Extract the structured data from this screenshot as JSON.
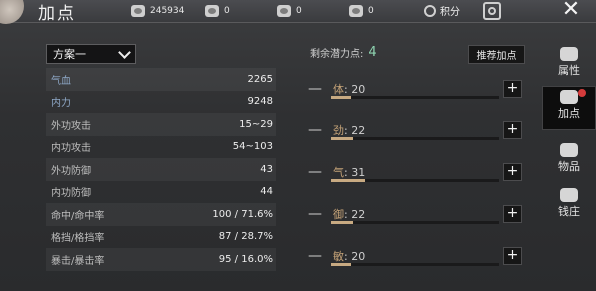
{
  "header": {
    "title": "加点",
    "resources": {
      "gold": "245934",
      "a": "0",
      "b": "0",
      "c": "0"
    },
    "score_label": "积分"
  },
  "left": {
    "plan_select": "方案一",
    "stats": [
      {
        "label": "气血",
        "value": "2265"
      },
      {
        "label": "内力",
        "value": "9248"
      },
      {
        "label": "外功攻击",
        "value": "15~29"
      },
      {
        "label": "内功攻击",
        "value": "54~103"
      },
      {
        "label": "外功防御",
        "value": "43"
      },
      {
        "label": "内功防御",
        "value": "44"
      },
      {
        "label": "命中/命中率",
        "value": "100 / 71.6%"
      },
      {
        "label": "格挡/格挡率",
        "value": "87 / 28.7%"
      },
      {
        "label": "暴击/暴击率",
        "value": "95 / 16.0%"
      }
    ]
  },
  "right": {
    "points_label": "剩余潜力点:",
    "points_value": "4",
    "recommend_label": "推荐加点",
    "attributes": [
      {
        "name": "体",
        "sep": ": ",
        "value": "20",
        "fill": 0.12
      },
      {
        "name": "劲",
        "sep": ": ",
        "value": "22",
        "fill": 0.13
      },
      {
        "name": "气",
        "sep": ": ",
        "value": "31",
        "fill": 0.2
      },
      {
        "name": "御",
        "sep": ": ",
        "value": "22",
        "fill": 0.13
      },
      {
        "name": "敏",
        "sep": ": ",
        "value": "20",
        "fill": 0.12
      }
    ]
  },
  "sidebar": {
    "tabs": [
      "属性",
      "加点",
      "物品",
      "钱庄"
    ]
  }
}
